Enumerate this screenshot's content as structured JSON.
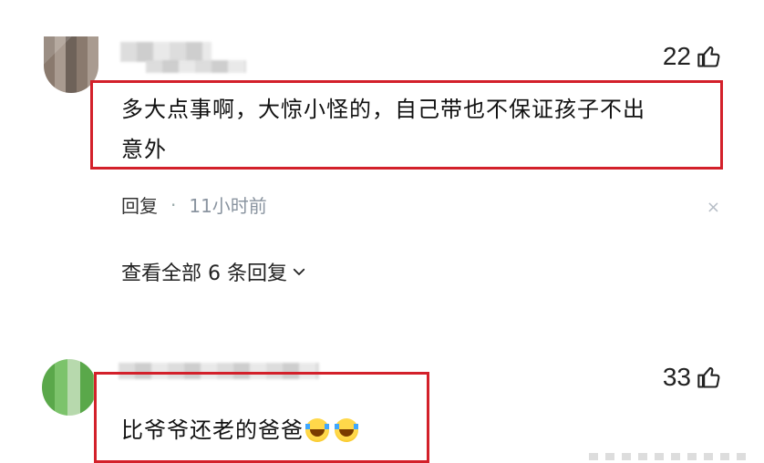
{
  "comments": [
    {
      "likes": "22",
      "text_line1": "多大点事啊，大惊小怪的，自己带也不保证孩子不出",
      "text_line2": "意外",
      "reply_label": "回复",
      "dot": "·",
      "time": "11小时前",
      "close_symbol": "×",
      "expand_label": "查看全部 6 条回复",
      "expand_symbol": "⌄"
    },
    {
      "likes": "33",
      "text": "比爷爷还老的爸爸",
      "emoji_count": 2
    }
  ],
  "icons": {
    "like": "thumbs-up-icon",
    "emoji": "laughing-crying-emoji-icon",
    "close": "close-icon",
    "expand": "chevron-down-icon"
  },
  "colors": {
    "highlight_border": "#d3202a",
    "meta_time": "#8a94a0"
  }
}
